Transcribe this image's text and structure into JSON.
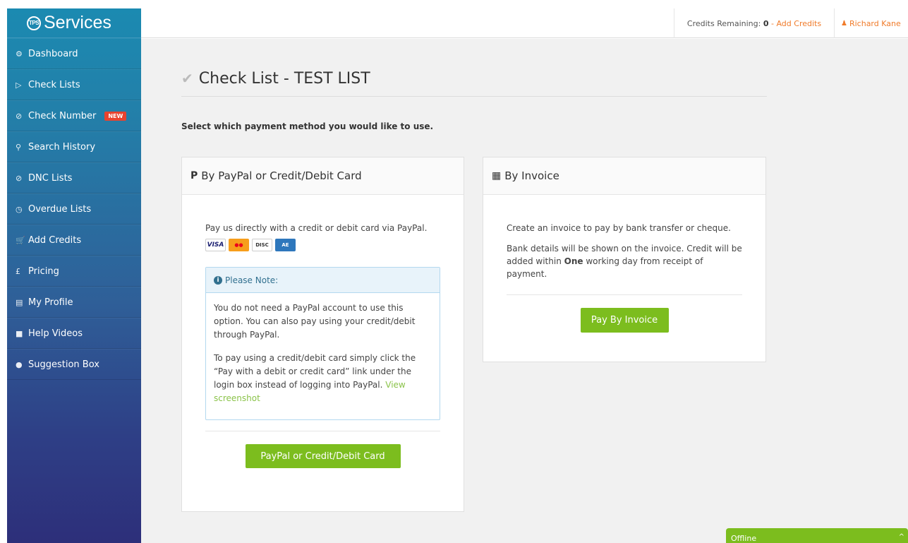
{
  "brand": {
    "logo_text": "TPS",
    "name": "Services"
  },
  "sidebar": {
    "items": [
      {
        "icon": "⚙",
        "label": "Dashboard"
      },
      {
        "icon": "▷",
        "label": "Check Lists"
      },
      {
        "icon": "⊘",
        "label": "Check Number",
        "badge": "NEW"
      },
      {
        "icon": "⚲",
        "label": "Search History"
      },
      {
        "icon": "⊘",
        "label": "DNC Lists"
      },
      {
        "icon": "◷",
        "label": "Overdue Lists"
      },
      {
        "icon": "🛒",
        "label": "Add Credits"
      },
      {
        "icon": "£",
        "label": "Pricing"
      },
      {
        "icon": "▤",
        "label": "My Profile"
      },
      {
        "icon": "■",
        "label": "Help Videos"
      },
      {
        "icon": "●",
        "label": "Suggestion Box"
      }
    ]
  },
  "topbar": {
    "credits_label": "Credits Remaining:",
    "credits_value": "0",
    "separator": " - ",
    "add_credits": "Add Credits",
    "user_name": "Richard Kane"
  },
  "page": {
    "title": "Check List - TEST LIST",
    "instruction": "Select which payment method you would like to use."
  },
  "paypal_panel": {
    "heading": "By PayPal or Credit/Debit Card",
    "intro": "Pay us directly with a credit or debit card via PayPal.",
    "cards": [
      "VISA",
      "MC",
      "DISCOVER",
      "AMEX"
    ],
    "note_heading": "Please Note:",
    "note_p1": "You do not need a PayPal account to use this option. You can also pay using your credit/debit through PayPal.",
    "note_p2": "To pay using a credit/debit card simply click the “Pay with a debit or credit card” link under the login box instead of logging into PayPal.",
    "note_link": "View screenshot",
    "button": "PayPal or Credit/Debit Card"
  },
  "invoice_panel": {
    "heading": "By Invoice",
    "p1": "Create an invoice to pay by bank transfer or cheque.",
    "p2_before": "Bank details will be shown on the invoice. Credit will be added within",
    "p2_bold": "One",
    "p2_after": "working day from receipt of payment.",
    "button": "Pay By Invoice"
  },
  "chat": {
    "status": "Offline"
  },
  "colors": {
    "accent_green": "#7cbd1e",
    "accent_orange": "#f07b2a",
    "info_blue": "#31708f"
  }
}
